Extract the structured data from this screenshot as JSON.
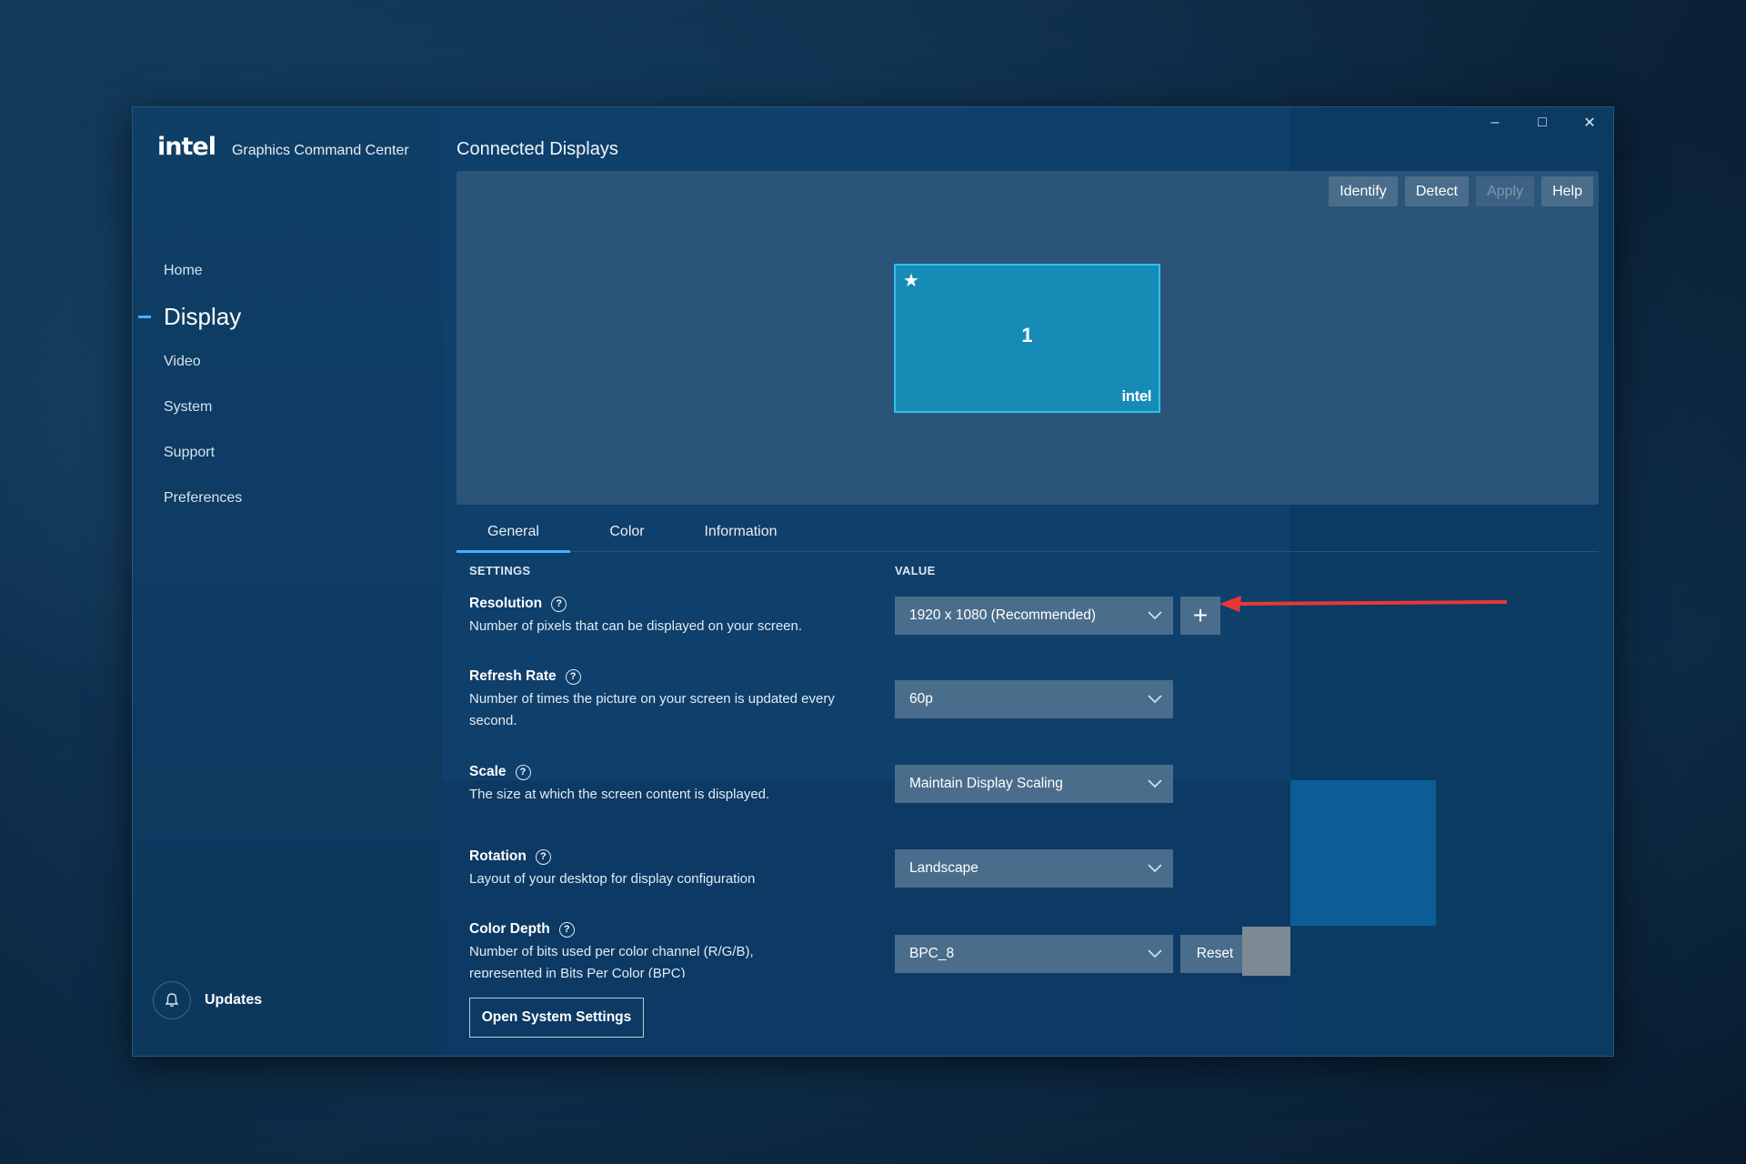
{
  "app": {
    "logo": "intel",
    "title": "Graphics Command Center"
  },
  "window_controls": {
    "minimize": "–",
    "maximize": "□",
    "close": "✕"
  },
  "sidebar": {
    "items": [
      {
        "label": "Home",
        "active": false
      },
      {
        "label": "Display",
        "active": true
      },
      {
        "label": "Video",
        "active": false
      },
      {
        "label": "System",
        "active": false
      },
      {
        "label": "Support",
        "active": false
      },
      {
        "label": "Preferences",
        "active": false
      }
    ],
    "updates_label": "Updates"
  },
  "main": {
    "section_title": "Connected Displays",
    "toolbar": {
      "identify": "Identify",
      "detect": "Detect",
      "apply": "Apply",
      "help": "Help"
    },
    "monitor": {
      "number": "1",
      "brand": "intel",
      "primary_icon": "star-icon"
    },
    "tabs": [
      {
        "label": "General",
        "active": true
      },
      {
        "label": "Color",
        "active": false
      },
      {
        "label": "Information",
        "active": false
      }
    ],
    "columns": {
      "settings": "SETTINGS",
      "value": "VALUE"
    },
    "settings": [
      {
        "name": "Resolution",
        "desc": "Number of pixels that can be displayed on your screen.",
        "value": "1920 x 1080 (Recommended)"
      },
      {
        "name": "Refresh Rate",
        "desc": "Number of times the picture on your screen is updated every second.",
        "value": "60p"
      },
      {
        "name": "Scale",
        "desc": "The size at which the screen content is displayed.",
        "value": "Maintain Display Scaling"
      },
      {
        "name": "Rotation",
        "desc": "Layout of your desktop for display configuration",
        "value": "Landscape"
      },
      {
        "name": "Color Depth",
        "desc": "Number of bits used per color channel (R/G/B), represented in Bits Per Color (BPC)",
        "value": "BPC_8"
      }
    ],
    "add_resolution_symbol": "+",
    "reset_label": "Reset",
    "open_system_settings": "Open System Settings"
  },
  "colors": {
    "accent": "#3fb6ff",
    "annotation_arrow": "#e53935",
    "monitor_fill": "#168bb5"
  }
}
